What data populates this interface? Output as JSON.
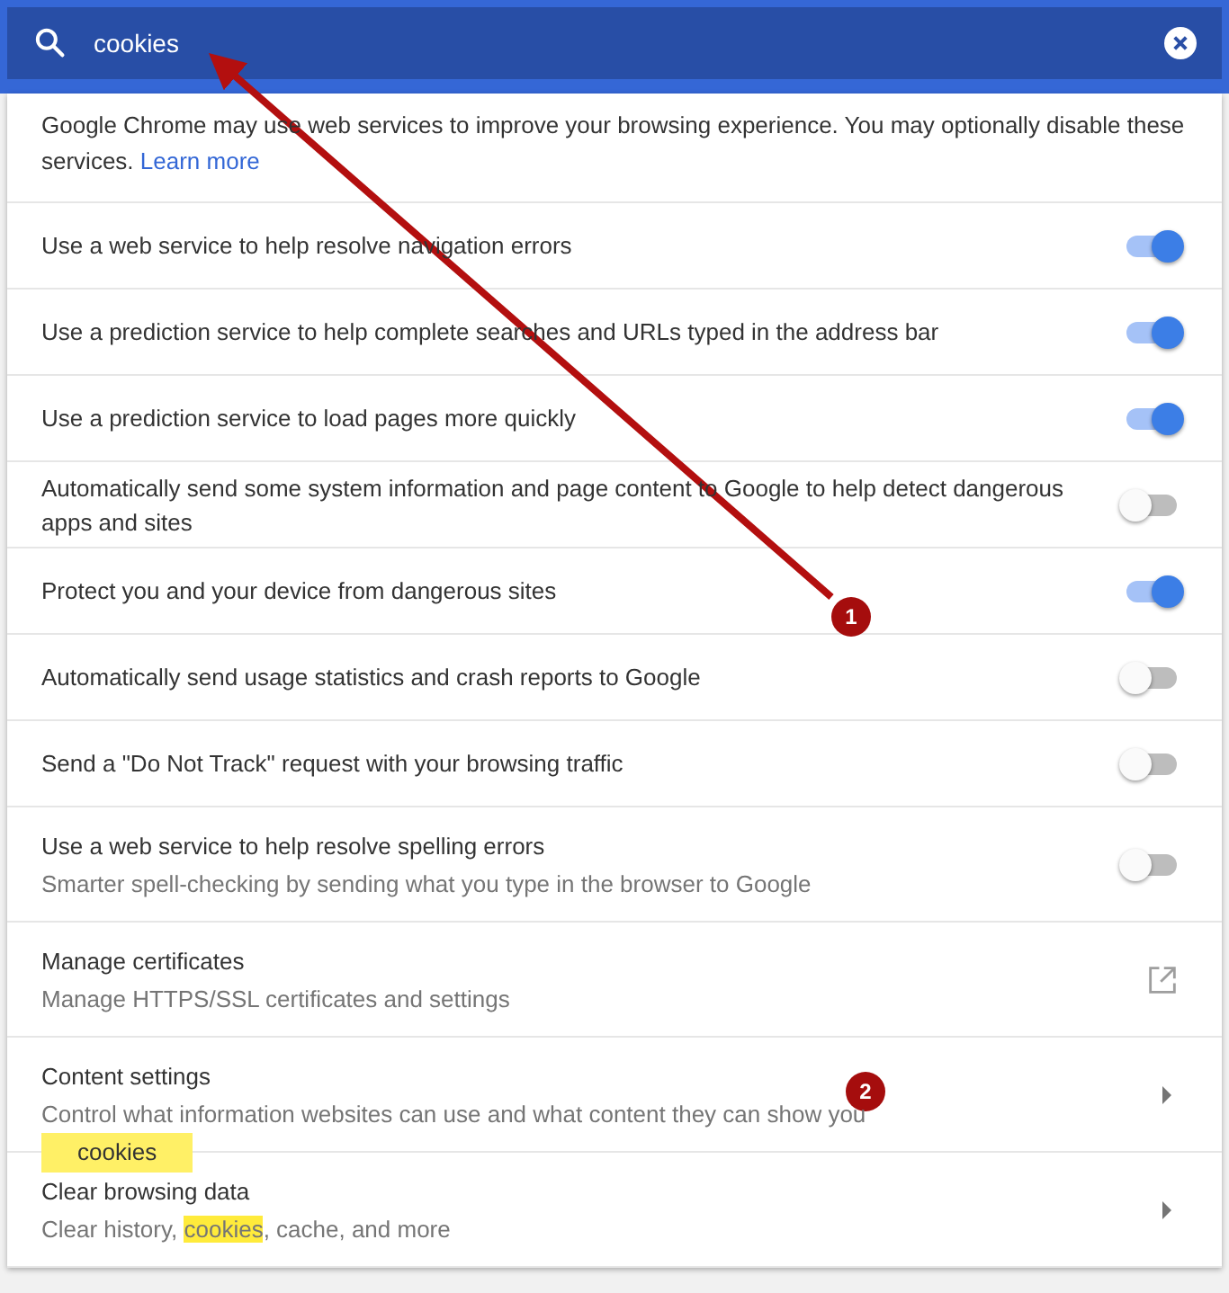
{
  "search": {
    "value": "cookies"
  },
  "intro": {
    "text": "Google Chrome may use web services to improve your browsing experience. You may optionally disable these services.",
    "link": "Learn more"
  },
  "rows": [
    {
      "kind": "toggle",
      "title": "Use a web service to help resolve navigation errors",
      "on": true
    },
    {
      "kind": "toggle",
      "title": "Use a prediction service to help complete searches and URLs typed in the address bar",
      "on": true
    },
    {
      "kind": "toggle",
      "title": "Use a prediction service to load pages more quickly",
      "on": true
    },
    {
      "kind": "toggle",
      "title": "Automatically send some system information and page content to Google to help detect dangerous apps and sites",
      "on": false
    },
    {
      "kind": "toggle",
      "title": "Protect you and your device from dangerous sites",
      "on": true
    },
    {
      "kind": "toggle",
      "title": "Automatically send usage statistics and crash reports to Google",
      "on": false
    },
    {
      "kind": "toggle",
      "title": "Send a \"Do Not Track\" request with your browsing traffic",
      "on": false
    },
    {
      "kind": "toggle",
      "title": "Use a web service to help resolve spelling errors",
      "subtitle": "Smarter spell-checking by sending what you type in the browser to Google",
      "on": false
    },
    {
      "kind": "external",
      "title": "Manage certificates",
      "subtitle": "Manage HTTPS/SSL certificates and settings"
    },
    {
      "kind": "arrow",
      "title": "Content settings",
      "subtitle": "Control what information websites can use and what content they can show you"
    },
    {
      "kind": "arrow",
      "title": "Clear browsing data",
      "subtitle_parts": [
        {
          "text": "Clear history, ",
          "highlight": false
        },
        {
          "text": "cookies",
          "highlight": true
        },
        {
          "text": ", cache, and more",
          "highlight": false
        }
      ]
    }
  ],
  "tooltip": "cookies",
  "badges": [
    "1",
    "2"
  ]
}
